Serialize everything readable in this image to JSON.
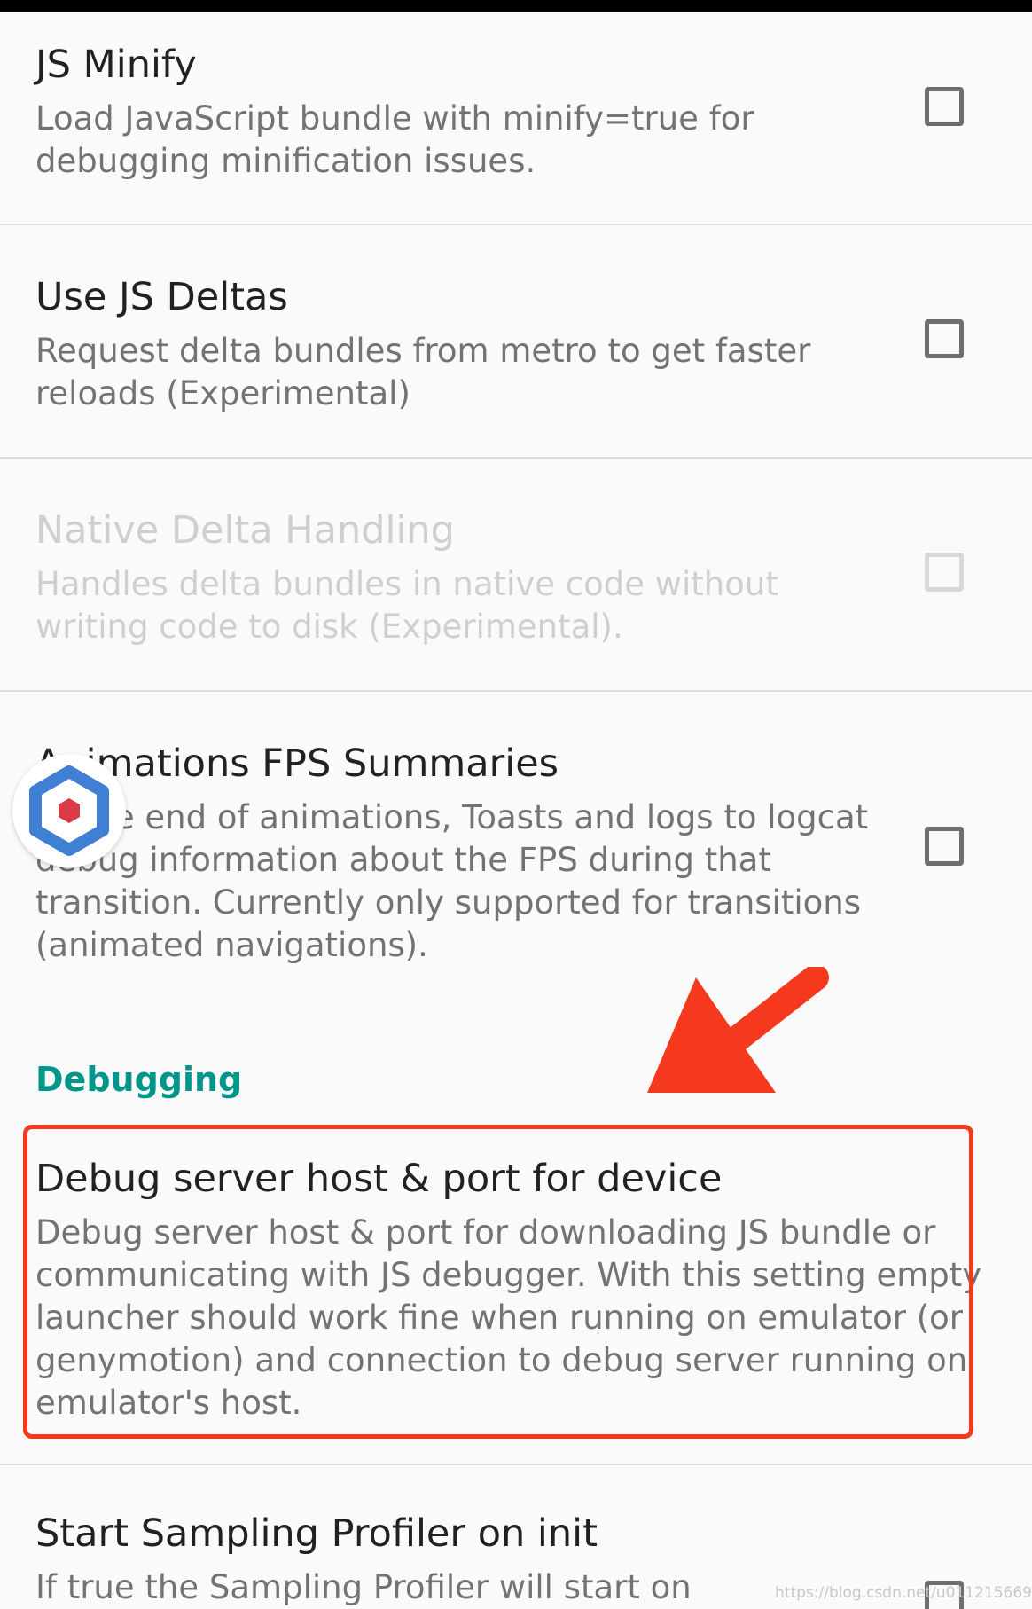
{
  "preferences": [
    {
      "title": "JS Minify",
      "summary": [
        "Load JavaScript bundle with minify=true for",
        "debugging minification issues."
      ],
      "checked": false,
      "enabled": true
    },
    {
      "title": "Use JS Deltas",
      "summary": [
        "Request delta bundles from metro to get faster",
        "reloads (Experimental)"
      ],
      "checked": false,
      "enabled": true
    },
    {
      "title": "Native Delta Handling",
      "summary": [
        "Handles delta bundles in native code without",
        "writing code to disk (Experimental)."
      ],
      "checked": false,
      "enabled": false
    },
    {
      "title": "Animations FPS Summaries",
      "summary": [
        "At the end of animations, Toasts and logs to logcat",
        "debug information about the FPS during that",
        "transition. Currently only supported for transitions",
        "(animated navigations)."
      ],
      "checked": false,
      "enabled": true
    }
  ],
  "category": {
    "label": "Debugging"
  },
  "debug_server": {
    "title": "Debug server host & port for device",
    "summary": [
      "Debug server host & port for downloading JS bundle or",
      "communicating with JS debugger. With this setting empty",
      "launcher should work fine when running on emulator (or",
      "genymotion) and connection to debug server running on",
      "emulator's host."
    ]
  },
  "sampling_profiler": {
    "title": "Start Sampling Profiler on init",
    "summary": [
      "If true the Sampling Profiler will start on"
    ],
    "checked": false
  },
  "annotation": {
    "highlight_color": "#f5391f",
    "arrow_color": "#f5391f"
  },
  "floating_logo": {
    "icon": "hexagon-logo-icon",
    "outer_color": "#3f7fd4",
    "inner_color": "#d83a48"
  },
  "watermark": "https://blog.csdn.net/u011215669"
}
